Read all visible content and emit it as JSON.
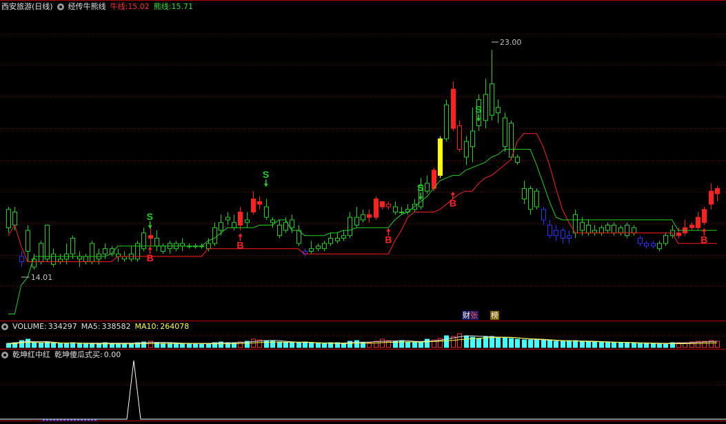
{
  "header": {
    "stock_name": "西安旅游(日线)",
    "indicator_name": "经传牛熊线",
    "bull_label": "牛线:",
    "bull_value": "15.02",
    "bear_label": "熊线:",
    "bear_value": "15.71"
  },
  "volume_header": {
    "label": "VOLUME:",
    "value": "334297",
    "ma5_label": "MA5:",
    "ma5_value": "338582",
    "ma10_label": "MA10:",
    "ma10_value": "264078"
  },
  "sub_header": {
    "name1": "乾坤红中红",
    "name2": "乾坤傻瓜式买:",
    "value": "0.00"
  },
  "annotations": {
    "high_label": "23.00",
    "low_label": "14.01",
    "badge_1": "财",
    "badge_2": "张",
    "badge_3": "榜"
  },
  "colors": {
    "up": "#ff2020",
    "down_green": "#20d020",
    "down_blue": "#3030ff",
    "bull_line": "#ff2020",
    "bear_line": "#20d020",
    "grid": "#7a0000",
    "highlight": "#ffff00",
    "volume_up": "#ff3030",
    "volume_down": "#40ffff",
    "ma10_line": "#ffff40"
  },
  "chart_data": {
    "type": "candlestick",
    "title": "西安旅游(日线)",
    "price_range": [
      14.01,
      23.0
    ],
    "signals": [
      {
        "label": "B",
        "color": "red"
      },
      {
        "label": "S",
        "color": "green"
      }
    ],
    "series": [
      {
        "name": "牛线",
        "last": 15.02
      },
      {
        "name": "熊线",
        "last": 15.71
      },
      {
        "name": "VOLUME",
        "last": 334297
      },
      {
        "name": "MA5",
        "last": 338582
      },
      {
        "name": "MA10",
        "last": 264078
      },
      {
        "name": "乾坤傻瓜式买",
        "last": 0.0
      }
    ]
  }
}
